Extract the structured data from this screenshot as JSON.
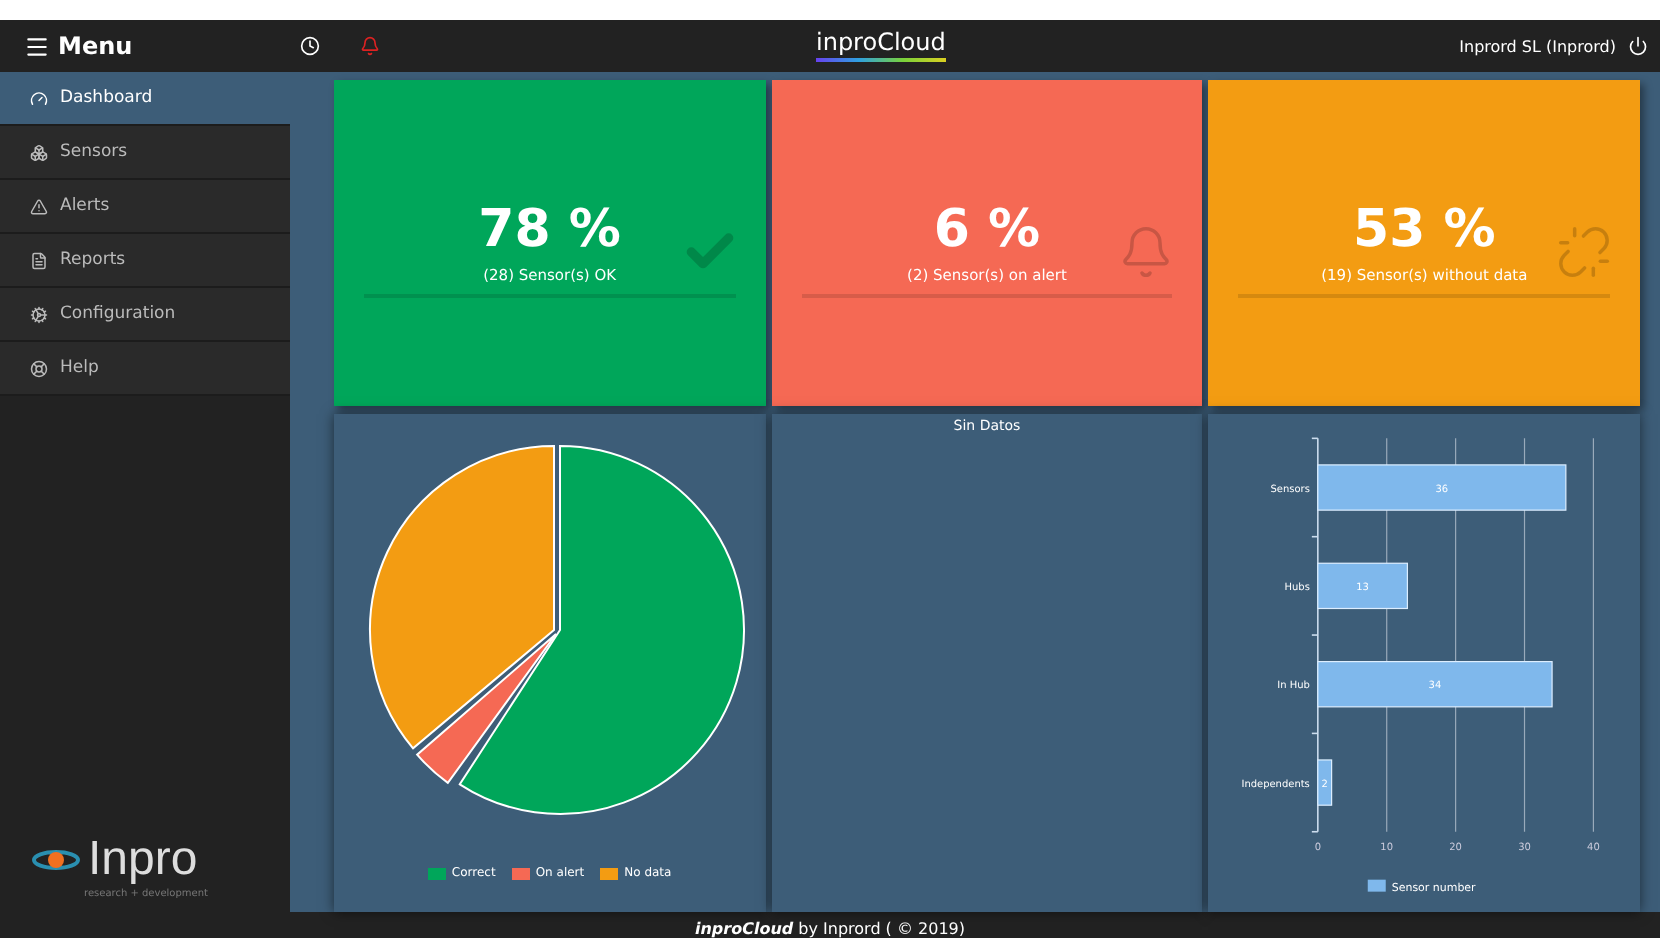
{
  "header": {
    "menu_label": "Menu",
    "brand": "inproCloud",
    "user": "Inprord SL (Inprord)"
  },
  "sidebar": {
    "items": [
      {
        "label": "Dashboard",
        "kind": "dashboard",
        "selected": true
      },
      {
        "label": "Sensors",
        "kind": "sensors",
        "selected": false
      },
      {
        "label": "Alerts",
        "kind": "alerts",
        "selected": false
      },
      {
        "label": "Reports",
        "kind": "reports",
        "selected": false
      },
      {
        "label": "Configuration",
        "kind": "configuration",
        "selected": false
      },
      {
        "label": "Help",
        "kind": "help",
        "selected": false
      }
    ],
    "logo": {
      "name": "Inpro",
      "tagline": "research + development"
    }
  },
  "cards": [
    {
      "kind": "ok",
      "value": "78 %",
      "caption": "(28) Sensor(s) OK"
    },
    {
      "kind": "alert",
      "value": "6 %",
      "caption": "(2) Sensor(s) on alert"
    },
    {
      "kind": "nodata",
      "value": "53 %",
      "caption": "(19) Sensor(s) without data"
    }
  ],
  "pie_panel": {
    "legend": [
      {
        "label": "Correct",
        "color": "#00a65a"
      },
      {
        "label": "On alert",
        "color": "#f56954"
      },
      {
        "label": "No data",
        "color": "#f39c12"
      }
    ]
  },
  "middle_panel": {
    "title": "Sin Datos"
  },
  "bar_panel": {
    "chart_data": {
      "type": "bar",
      "orientation": "horizontal",
      "categories": [
        "Sensors",
        "Hubs",
        "In Hub",
        "Independents"
      ],
      "series": [
        {
          "name": "Sensor number",
          "color": "#7fb8ec",
          "values": [
            36,
            13,
            34,
            2
          ]
        }
      ],
      "xlim": [
        0,
        40
      ],
      "xticks": [
        0,
        10,
        20,
        30,
        40
      ],
      "data_labels": true,
      "grid": true
    }
  },
  "footer": {
    "text": "**inproCloud** by Inprord ( © 2019)"
  }
}
